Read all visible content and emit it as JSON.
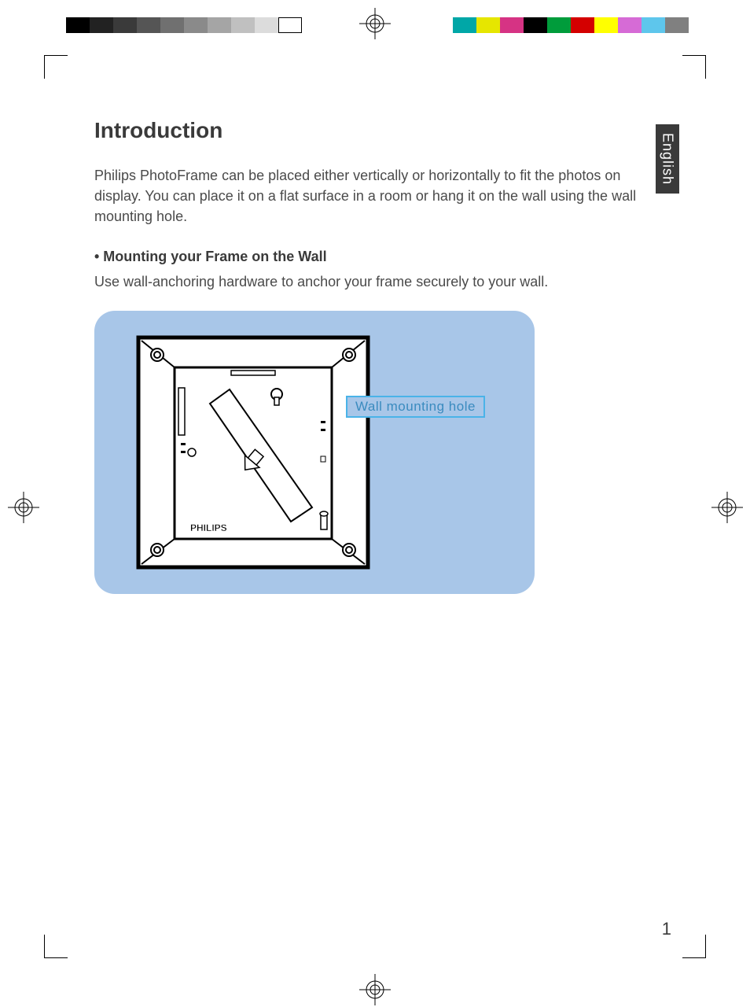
{
  "language_tab": "English",
  "page_number": "1",
  "heading": "Introduction",
  "intro_paragraph": "Philips PhotoFrame can be placed either vertically or horizontally to fit the photos on display. You can place it on a flat surface in a room or hang it on the wall using the wall mounting hole.",
  "mounting_bullet": "• Mounting your Frame on the Wall",
  "mounting_text": "Use wall-anchoring hardware to anchor your frame securely to your wall.",
  "callout_label": "Wall mounting hole",
  "device_brand": "PHILIPS",
  "gray_swatches": [
    "#000000",
    "#222222",
    "#3a3a3a",
    "#555555",
    "#707070",
    "#8a8a8a",
    "#a5a5a5",
    "#c0c0c0",
    "#dcdcdc",
    "#ffffff"
  ],
  "color_swatches": [
    "#00a7a7",
    "#e6e600",
    "#d63384",
    "#000000",
    "#009c3b",
    "#d40000",
    "#ffff00",
    "#d66bd6",
    "#5ec6ec",
    "#808080"
  ]
}
